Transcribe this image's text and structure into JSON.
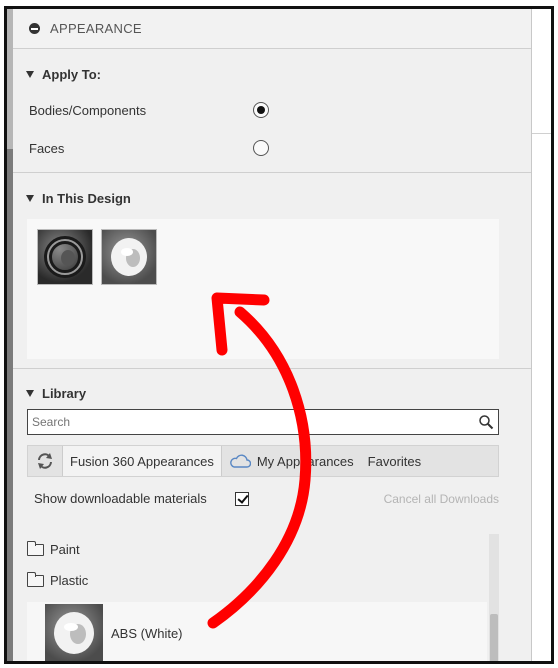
{
  "panel": {
    "title": "APPEARANCE"
  },
  "apply_to": {
    "heading": "Apply To:",
    "options": [
      {
        "label": "Bodies/Components",
        "selected": true
      },
      {
        "label": "Faces",
        "selected": false
      }
    ]
  },
  "in_this_design": {
    "heading": "In This Design"
  },
  "library": {
    "heading": "Library",
    "search_placeholder": "Search",
    "tabs": [
      "Fusion 360 Appearances",
      "My Appearances",
      "Favorites"
    ],
    "active_tab": "Fusion 360 Appearances",
    "show_downloadable_label": "Show downloadable materials",
    "show_downloadable_checked": true,
    "cancel_downloads_label": "Cancel all Downloads",
    "tree": [
      "Paint",
      "Plastic"
    ],
    "material_label": "ABS (White)"
  },
  "colors": {
    "annotation_arrow": "#ff0000",
    "panel_bg": "#f0f0f0"
  }
}
